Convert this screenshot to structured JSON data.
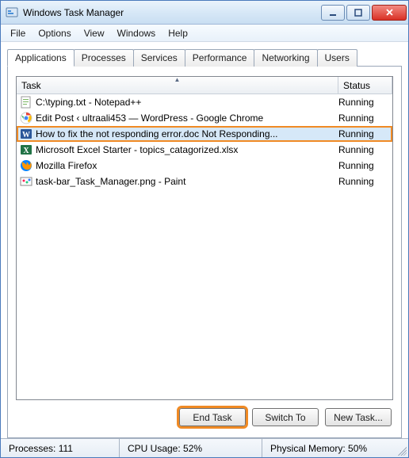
{
  "window": {
    "title": "Windows Task Manager"
  },
  "menu": {
    "file": "File",
    "options": "Options",
    "view": "View",
    "windows": "Windows",
    "help": "Help"
  },
  "tabs": [
    {
      "label": "Applications",
      "active": true
    },
    {
      "label": "Processes"
    },
    {
      "label": "Services"
    },
    {
      "label": "Performance"
    },
    {
      "label": "Networking"
    },
    {
      "label": "Users"
    }
  ],
  "columns": {
    "task": "Task",
    "status": "Status"
  },
  "tasks": [
    {
      "icon": "notepadpp",
      "name": "C:\\typing.txt - Notepad++",
      "status": "Running"
    },
    {
      "icon": "chrome",
      "name": "Edit Post ‹ ultraali453 — WordPress - Google Chrome",
      "status": "Running"
    },
    {
      "icon": "word",
      "name": "How to fix the not responding error.doc Not Responding...",
      "status": "Running",
      "selected": true,
      "highlight": true
    },
    {
      "icon": "excel",
      "name": "Microsoft Excel Starter - topics_catagorized.xlsx",
      "status": "Running"
    },
    {
      "icon": "firefox",
      "name": "Mozilla Firefox",
      "status": "Running"
    },
    {
      "icon": "paint",
      "name": "task-bar_Task_Manager.png - Paint",
      "status": "Running"
    }
  ],
  "buttons": {
    "end_task": "End Task",
    "switch_to": "Switch To",
    "new_task": "New Task..."
  },
  "statusbar": {
    "processes": "Processes: 111",
    "cpu": "CPU Usage: 52%",
    "memory": "Physical Memory: 50%"
  },
  "icons": {
    "notepadpp": "#7bb661",
    "chrome": "#f2c94c",
    "word": "#2b579a",
    "excel": "#217346",
    "firefox": "#e66000",
    "paint": "#5aa9e6"
  }
}
